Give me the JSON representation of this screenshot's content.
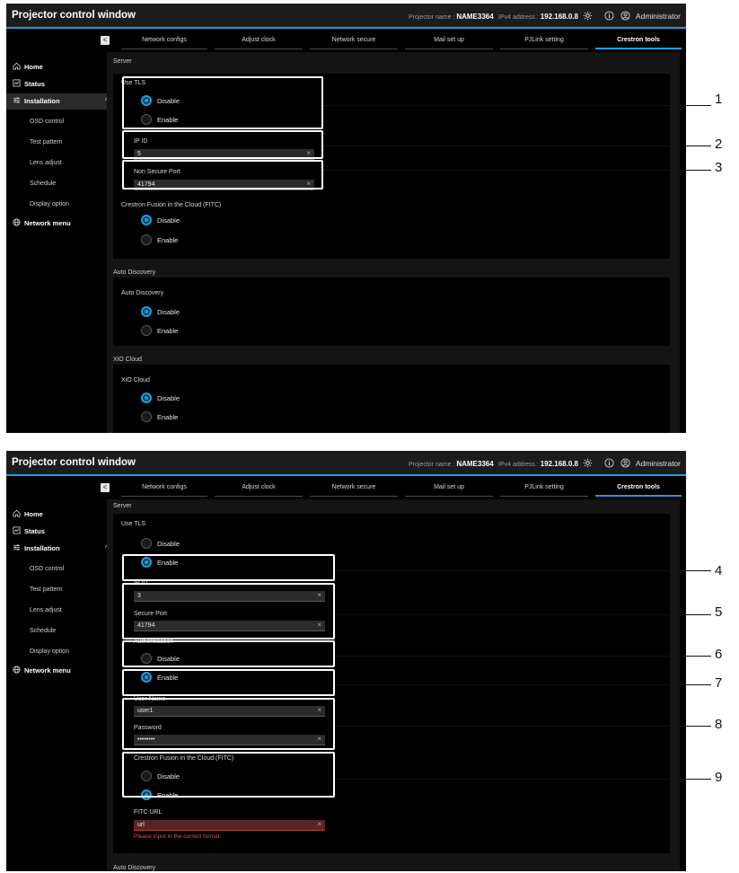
{
  "app": {
    "title": "Projector control window",
    "projector_name_label": "Projector name :",
    "projector_name": "NAME3364",
    "ipv4_label": "IPv4 address :",
    "ipv4": "192.168.0.8",
    "user": "Administrator",
    "collapse_glyph": "<"
  },
  "sidebar": {
    "home": "Home",
    "status": "Status",
    "installation": "Installation",
    "installation_chevron": "^",
    "sub_items": [
      "OSD control",
      "Test pattern",
      "Lens adjust",
      "Schedule",
      "Display option"
    ],
    "network_menu": "Network menu"
  },
  "tabs": [
    "Network configs",
    "Adjust clock",
    "Network secure",
    "Mail set up",
    "PJLink setting",
    "Crestron tools"
  ],
  "icons": {
    "clear": "×",
    "home": "home-icon",
    "status": "status-icon",
    "installation": "sliders-icon",
    "network": "globe-icon",
    "settings": "gear-icon",
    "info": "info-icon",
    "user": "user-icon"
  },
  "colors": {
    "accent": "#1f9be0",
    "error": "#e05050"
  },
  "top": {
    "server_section": "Server",
    "use_tls_label": "Use TLS",
    "use_tls_options": [
      "Disable",
      "Enable"
    ],
    "ip_id_label": "IP ID",
    "ip_id_value": "5",
    "non_secure_port_label": "Non Secure Port",
    "non_secure_port_value": "41794",
    "fitc_label": "Crestron Fusion in the Cloud (FITC)",
    "fitc_options": [
      "Disable",
      "Enable"
    ],
    "auto_discovery_section": "Auto Discovery",
    "auto_discovery_label": "Auto Discovery",
    "auto_discovery_options": [
      "Disable",
      "Enable"
    ],
    "xio_section": "XiO Cloud",
    "xio_label": "XiO Cloud",
    "xio_options": [
      "Disable",
      "Enable"
    ]
  },
  "bottom": {
    "server_section": "Server",
    "use_tls_label": "Use TLS",
    "use_tls_options": [
      "Disable",
      "Enable"
    ],
    "ip_id_label": "IP ID",
    "ip_id_value": "3",
    "secure_port_label": "Secure Port",
    "secure_port_value": "41794",
    "auth_label": "Authentication",
    "auth_options": [
      "Disable",
      "Enable"
    ],
    "user_name_label": "User Name",
    "user_name_value": "user1",
    "password_label": "Password",
    "password_value": "••••••••",
    "fitc_label": "Crestron Fusion in the Cloud (FITC)",
    "fitc_options": [
      "Disable",
      "Enable"
    ],
    "fitc_url_label": "FITC URL",
    "fitc_url_value": "url",
    "fitc_url_error": "Please input in the correct format.",
    "auto_discovery_section": "Auto Discovery"
  },
  "callouts": [
    "1",
    "2",
    "3",
    "4",
    "5",
    "6",
    "7",
    "8",
    "9"
  ]
}
